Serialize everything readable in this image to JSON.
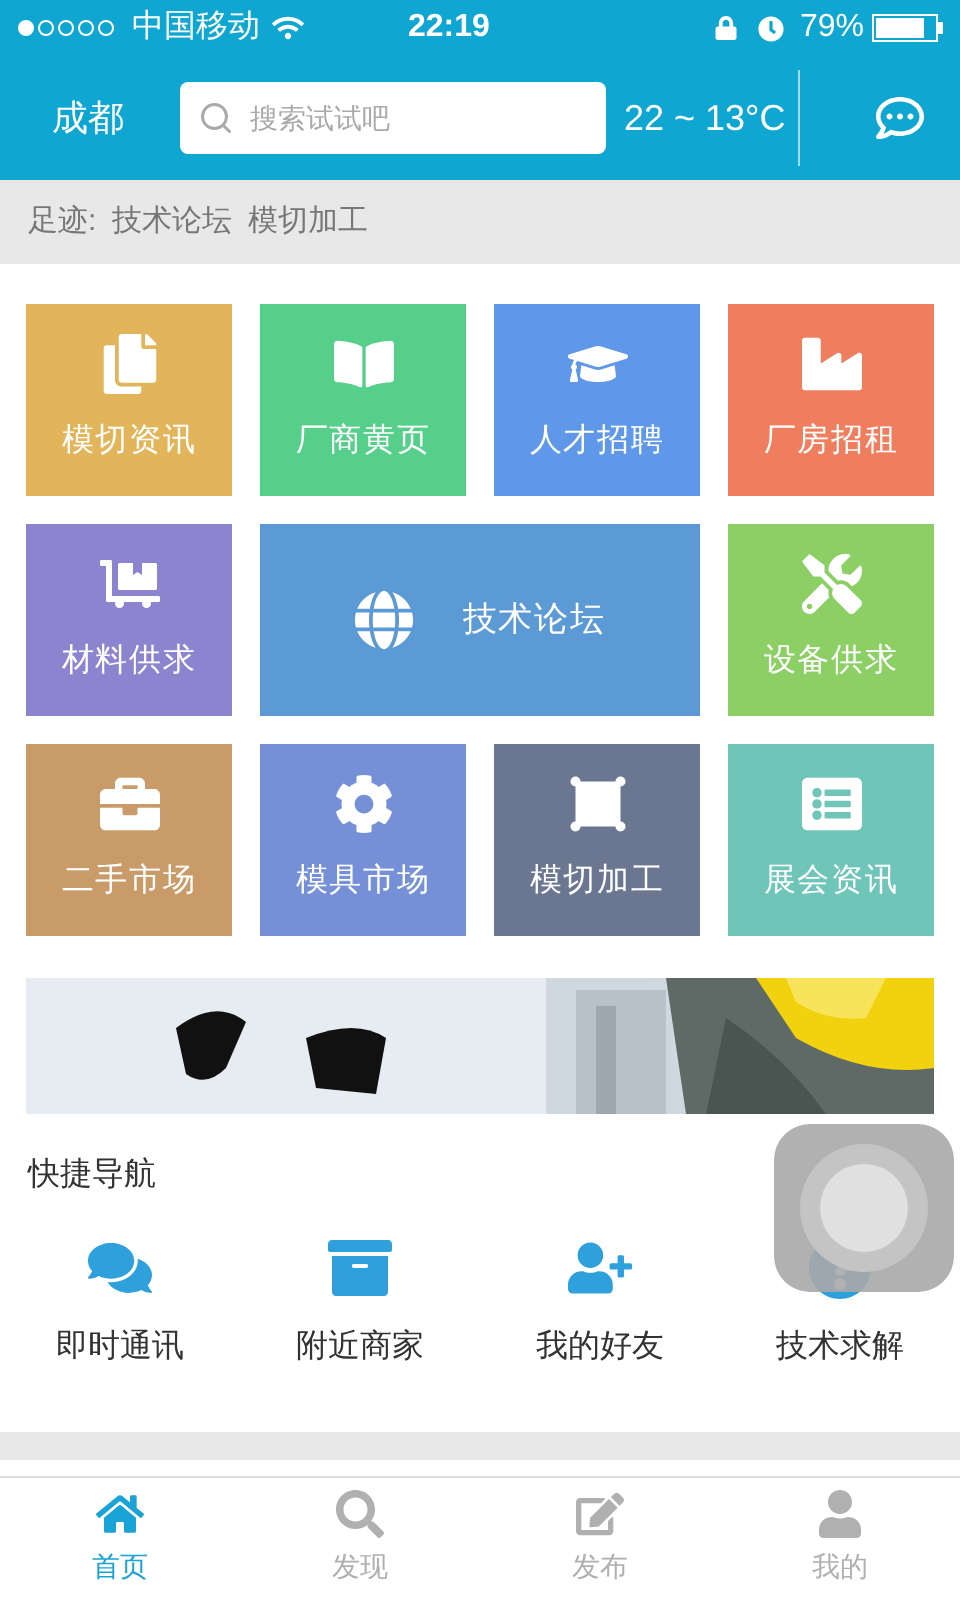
{
  "status_bar": {
    "carrier": "中国移动",
    "time": "22:19",
    "battery": "79%"
  },
  "header": {
    "city": "成都",
    "search": {
      "placeholder": "搜索试试吧"
    },
    "weather": "22 ~ 13°C"
  },
  "footprint": {
    "label": "足迹:",
    "items": [
      "技术论坛",
      "模切加工"
    ]
  },
  "tiles": [
    {
      "label": "模切资讯",
      "color": "#e3b55b",
      "kind": "tile"
    },
    {
      "label": "厂商黄页",
      "color": "#55cf8a",
      "kind": "tile"
    },
    {
      "label": "人才招聘",
      "color": "#5f98e8",
      "kind": "tile"
    },
    {
      "label": "厂房招租",
      "color": "#ee7e5e",
      "kind": "tile"
    },
    {
      "label": "材料供求",
      "color": "#8c84cf",
      "kind": "tile"
    },
    {
      "label": "技术论坛",
      "color": "#5b9ad4",
      "kind": "wide"
    },
    {
      "label": "设备供求",
      "color": "#8ccf64",
      "kind": "tile"
    },
    {
      "label": "二手市场",
      "color": "#c99b69",
      "kind": "tile"
    },
    {
      "label": "模具市场",
      "color": "#7590d6",
      "kind": "tile"
    },
    {
      "label": "模切加工",
      "color": "#6b7791",
      "kind": "tile"
    },
    {
      "label": "展会资讯",
      "color": "#6ec5b8",
      "kind": "tile"
    }
  ],
  "quick_nav": {
    "title": "快捷导航",
    "items": [
      "即时通讯",
      "附近商家",
      "我的好友",
      "技术求解"
    ]
  },
  "tabs": [
    {
      "label": "首页",
      "selected": true
    },
    {
      "label": "发现",
      "selected": false
    },
    {
      "label": "发布",
      "selected": false
    },
    {
      "label": "我的",
      "selected": false
    }
  ]
}
